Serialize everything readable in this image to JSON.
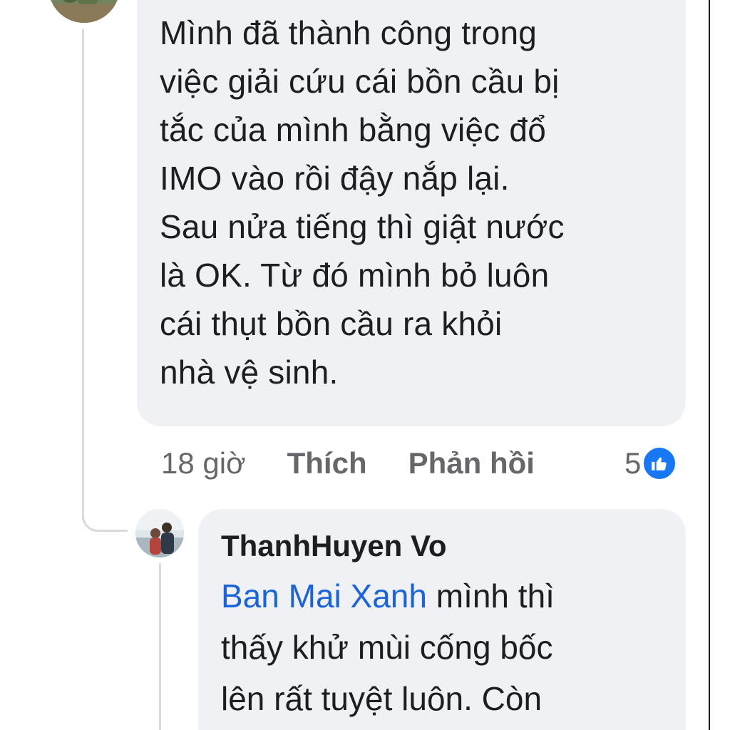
{
  "comment": {
    "lines": [
      "Mình đã thành công trong",
      "việc giải cứu cái bồn cầu bị",
      "tắc của mình bằng việc đổ",
      "IMO vào rồi đậy nắp lại.",
      "Sau nửa tiếng thì giật nước",
      "là OK. Từ đó mình bỏ luôn",
      "cái thụt bồn cầu ra khỏi",
      "nhà vệ sinh."
    ],
    "time": "18 giờ",
    "like_label": "Thích",
    "reply_label": "Phản hồi",
    "reaction_count": "5"
  },
  "reply": {
    "author": "ThanhHuyen Vo",
    "mention": "Ban Mai Xanh",
    "first_line_rest": " mình thì",
    "lines": [
      "thấy khử mùi cống bốc",
      "lên rất tuyệt luôn. Còn"
    ]
  },
  "colors": {
    "bubble": "#f0f1f4",
    "mention": "#1b64d8",
    "like_badge": "#1877f2",
    "meta_text": "#65676b"
  },
  "icons": {
    "reaction": "like-icon"
  }
}
